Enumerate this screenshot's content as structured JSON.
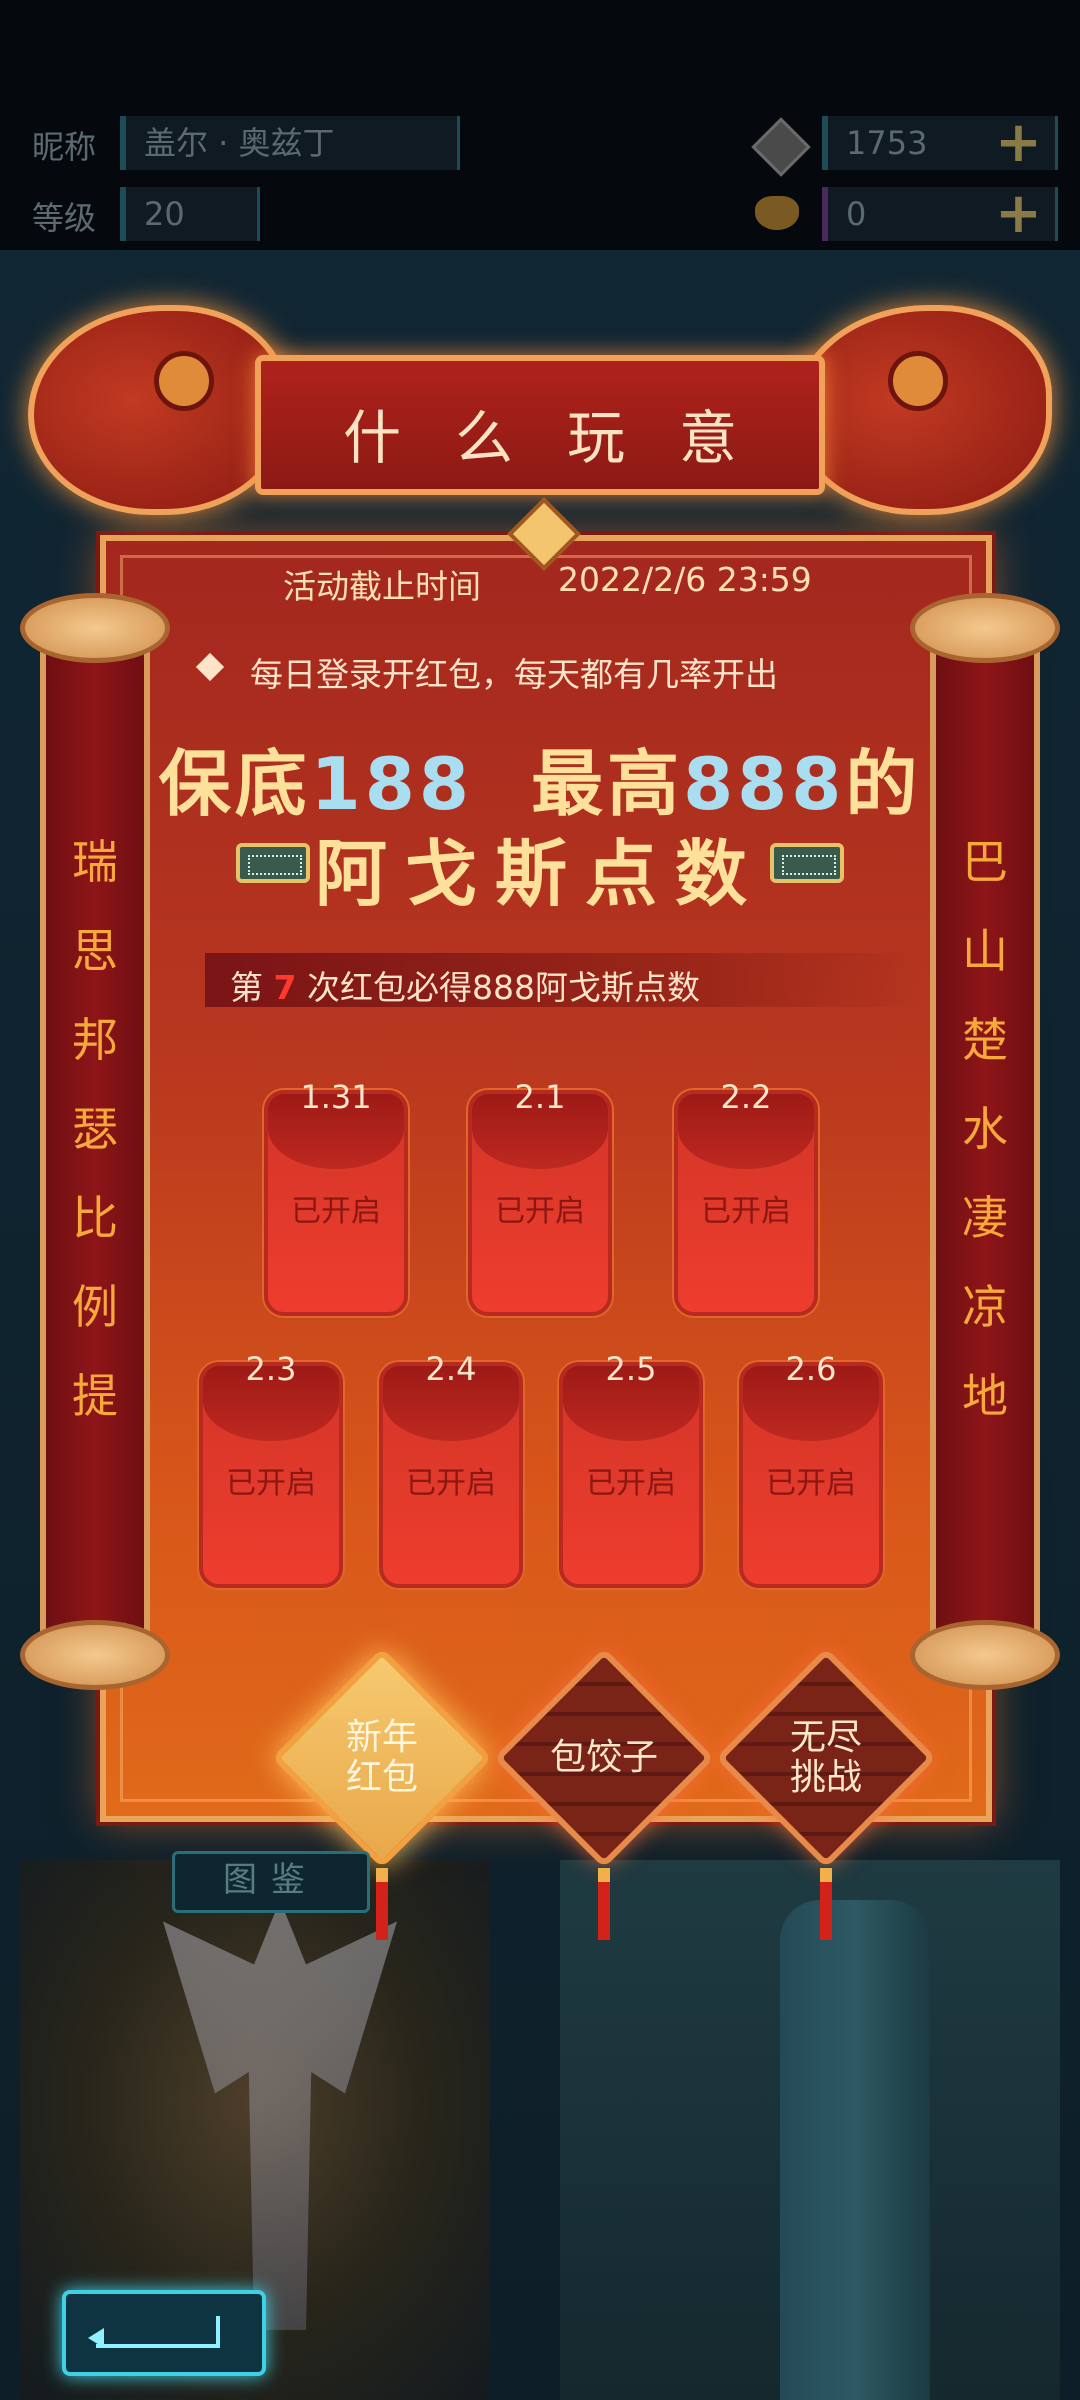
{
  "profile": {
    "nickname_label": "昵称",
    "nickname": "盖尔 · 奥兹丁",
    "level_label": "等级",
    "level": "20",
    "currency1_icon": "coin-icon",
    "currency1": "1753",
    "currency2_icon": "cat-coin-icon",
    "currency2": "0"
  },
  "event": {
    "title": "什么玩意",
    "deadline_label": "活动截止时间",
    "deadline": "2022/2/6 23:59",
    "rule": "每日登录开红包，每天都有几率开出",
    "headline_prefix": "保底",
    "headline_min": "188",
    "headline_mid": "最高",
    "headline_max": "888",
    "headline_suffix": "的",
    "headline2": "阿戈斯点数",
    "counter_prefix": "第",
    "counter_num": "7",
    "counter_suffix": "次红包必得888阿戈斯点数",
    "left_scroll": "瑞思邦瑟比例提",
    "right_scroll": "巴山楚水凄凉地"
  },
  "envelopes": [
    {
      "date": "1.31",
      "status": "已开启"
    },
    {
      "date": "2.1",
      "status": "已开启"
    },
    {
      "date": "2.2",
      "status": "已开启"
    },
    {
      "date": "2.3",
      "status": "已开启"
    },
    {
      "date": "2.4",
      "status": "已开启"
    },
    {
      "date": "2.5",
      "status": "已开启"
    },
    {
      "date": "2.6",
      "status": "已开启"
    }
  ],
  "tabs": [
    {
      "label_line1": "新年",
      "label_line2": "红包",
      "active": true
    },
    {
      "label_line1": "包饺子",
      "label_line2": "",
      "active": false
    },
    {
      "label_line1": "无尽",
      "label_line2": "挑战",
      "active": false
    }
  ],
  "bottom": {
    "gallery_label": "图鉴",
    "back_icon": "back-arrow-icon"
  },
  "colors": {
    "accent_gold": "#fde19a",
    "accent_blue": "#a9ddf0",
    "panel_red": "#b8371f",
    "envelope_red": "#ee3d2e"
  }
}
